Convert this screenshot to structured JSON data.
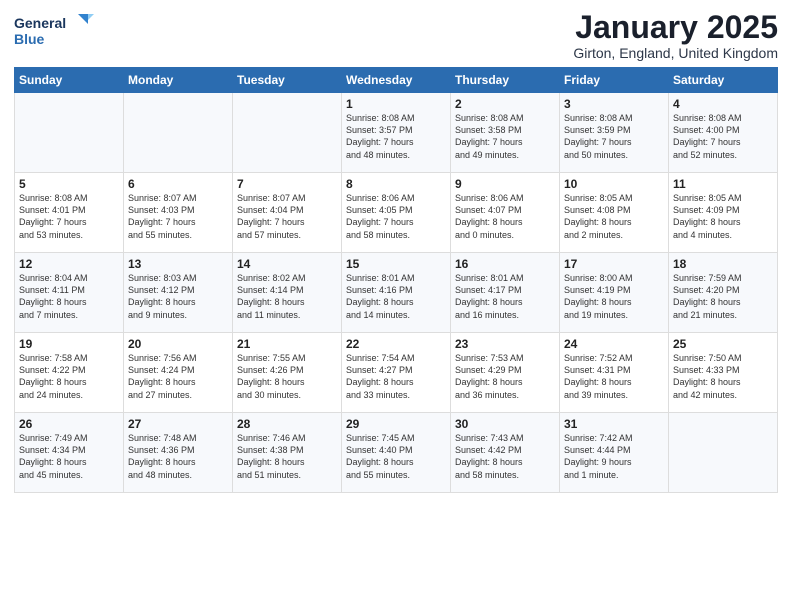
{
  "logo": {
    "line1": "General",
    "line2": "Blue"
  },
  "title": "January 2025",
  "location": "Girton, England, United Kingdom",
  "days_of_week": [
    "Sunday",
    "Monday",
    "Tuesday",
    "Wednesday",
    "Thursday",
    "Friday",
    "Saturday"
  ],
  "weeks": [
    [
      {
        "day": "",
        "text": ""
      },
      {
        "day": "",
        "text": ""
      },
      {
        "day": "",
        "text": ""
      },
      {
        "day": "1",
        "text": "Sunrise: 8:08 AM\nSunset: 3:57 PM\nDaylight: 7 hours\nand 48 minutes."
      },
      {
        "day": "2",
        "text": "Sunrise: 8:08 AM\nSunset: 3:58 PM\nDaylight: 7 hours\nand 49 minutes."
      },
      {
        "day": "3",
        "text": "Sunrise: 8:08 AM\nSunset: 3:59 PM\nDaylight: 7 hours\nand 50 minutes."
      },
      {
        "day": "4",
        "text": "Sunrise: 8:08 AM\nSunset: 4:00 PM\nDaylight: 7 hours\nand 52 minutes."
      }
    ],
    [
      {
        "day": "5",
        "text": "Sunrise: 8:08 AM\nSunset: 4:01 PM\nDaylight: 7 hours\nand 53 minutes."
      },
      {
        "day": "6",
        "text": "Sunrise: 8:07 AM\nSunset: 4:03 PM\nDaylight: 7 hours\nand 55 minutes."
      },
      {
        "day": "7",
        "text": "Sunrise: 8:07 AM\nSunset: 4:04 PM\nDaylight: 7 hours\nand 57 minutes."
      },
      {
        "day": "8",
        "text": "Sunrise: 8:06 AM\nSunset: 4:05 PM\nDaylight: 7 hours\nand 58 minutes."
      },
      {
        "day": "9",
        "text": "Sunrise: 8:06 AM\nSunset: 4:07 PM\nDaylight: 8 hours\nand 0 minutes."
      },
      {
        "day": "10",
        "text": "Sunrise: 8:05 AM\nSunset: 4:08 PM\nDaylight: 8 hours\nand 2 minutes."
      },
      {
        "day": "11",
        "text": "Sunrise: 8:05 AM\nSunset: 4:09 PM\nDaylight: 8 hours\nand 4 minutes."
      }
    ],
    [
      {
        "day": "12",
        "text": "Sunrise: 8:04 AM\nSunset: 4:11 PM\nDaylight: 8 hours\nand 7 minutes."
      },
      {
        "day": "13",
        "text": "Sunrise: 8:03 AM\nSunset: 4:12 PM\nDaylight: 8 hours\nand 9 minutes."
      },
      {
        "day": "14",
        "text": "Sunrise: 8:02 AM\nSunset: 4:14 PM\nDaylight: 8 hours\nand 11 minutes."
      },
      {
        "day": "15",
        "text": "Sunrise: 8:01 AM\nSunset: 4:16 PM\nDaylight: 8 hours\nand 14 minutes."
      },
      {
        "day": "16",
        "text": "Sunrise: 8:01 AM\nSunset: 4:17 PM\nDaylight: 8 hours\nand 16 minutes."
      },
      {
        "day": "17",
        "text": "Sunrise: 8:00 AM\nSunset: 4:19 PM\nDaylight: 8 hours\nand 19 minutes."
      },
      {
        "day": "18",
        "text": "Sunrise: 7:59 AM\nSunset: 4:20 PM\nDaylight: 8 hours\nand 21 minutes."
      }
    ],
    [
      {
        "day": "19",
        "text": "Sunrise: 7:58 AM\nSunset: 4:22 PM\nDaylight: 8 hours\nand 24 minutes."
      },
      {
        "day": "20",
        "text": "Sunrise: 7:56 AM\nSunset: 4:24 PM\nDaylight: 8 hours\nand 27 minutes."
      },
      {
        "day": "21",
        "text": "Sunrise: 7:55 AM\nSunset: 4:26 PM\nDaylight: 8 hours\nand 30 minutes."
      },
      {
        "day": "22",
        "text": "Sunrise: 7:54 AM\nSunset: 4:27 PM\nDaylight: 8 hours\nand 33 minutes."
      },
      {
        "day": "23",
        "text": "Sunrise: 7:53 AM\nSunset: 4:29 PM\nDaylight: 8 hours\nand 36 minutes."
      },
      {
        "day": "24",
        "text": "Sunrise: 7:52 AM\nSunset: 4:31 PM\nDaylight: 8 hours\nand 39 minutes."
      },
      {
        "day": "25",
        "text": "Sunrise: 7:50 AM\nSunset: 4:33 PM\nDaylight: 8 hours\nand 42 minutes."
      }
    ],
    [
      {
        "day": "26",
        "text": "Sunrise: 7:49 AM\nSunset: 4:34 PM\nDaylight: 8 hours\nand 45 minutes."
      },
      {
        "day": "27",
        "text": "Sunrise: 7:48 AM\nSunset: 4:36 PM\nDaylight: 8 hours\nand 48 minutes."
      },
      {
        "day": "28",
        "text": "Sunrise: 7:46 AM\nSunset: 4:38 PM\nDaylight: 8 hours\nand 51 minutes."
      },
      {
        "day": "29",
        "text": "Sunrise: 7:45 AM\nSunset: 4:40 PM\nDaylight: 8 hours\nand 55 minutes."
      },
      {
        "day": "30",
        "text": "Sunrise: 7:43 AM\nSunset: 4:42 PM\nDaylight: 8 hours\nand 58 minutes."
      },
      {
        "day": "31",
        "text": "Sunrise: 7:42 AM\nSunset: 4:44 PM\nDaylight: 9 hours\nand 1 minute."
      },
      {
        "day": "",
        "text": ""
      }
    ]
  ]
}
